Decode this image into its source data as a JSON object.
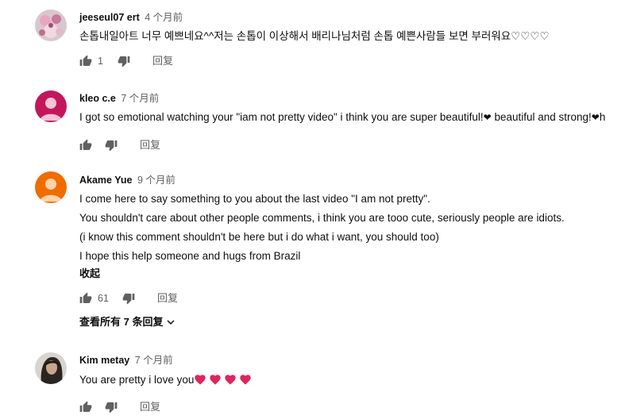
{
  "comments": [
    {
      "author": "jeeseul07 ert",
      "time": "4 个月前",
      "lines": [
        "손톱내일아트 너무 예쁘네요^^저는 손톱이 이상해서 배리나님처럼 손톱 예쁜사람들 보면 부러워요♡♡♡♡"
      ],
      "likes": "1",
      "reply_label": "回复"
    },
    {
      "author": "kleo c.e",
      "time": "7 个月前",
      "lines_parts": [
        "I got so emotional watching your \"iam not pretty video\" i think you are super beautiful!",
        " beautiful and strong!",
        "h"
      ],
      "likes": "",
      "reply_label": "回复"
    },
    {
      "author": "Akame Yue",
      "time": "9 个月前",
      "lines": [
        "I come here to say something to you about the last video \"I am not pretty\".",
        "You shouldn't care about other people comments, i think you are tooo cute, seriously people are idiots.",
        "(i know this comment shouldn't be here but i do what i want, you should too)",
        "I hope this help someone and hugs from Brazil"
      ],
      "collapse_label": "收起",
      "likes": "61",
      "reply_label": "回复",
      "view_replies_label": "查看所有 7 条回复"
    },
    {
      "author": "Kim metay",
      "time": "7 个月前",
      "lines": [
        "You are pretty i love you"
      ],
      "likes": "",
      "reply_label": "回复"
    }
  ],
  "icons": {
    "like": "thumb-up-icon",
    "dislike": "thumb-down-icon",
    "heart": "heart-icon",
    "chevron": "chevron-down-icon"
  },
  "colors": {
    "avatar_kleo": "#c2185b",
    "avatar_akame": "#ef6c00",
    "heart_red": "#e0245e",
    "secondary_text": "#606060"
  }
}
